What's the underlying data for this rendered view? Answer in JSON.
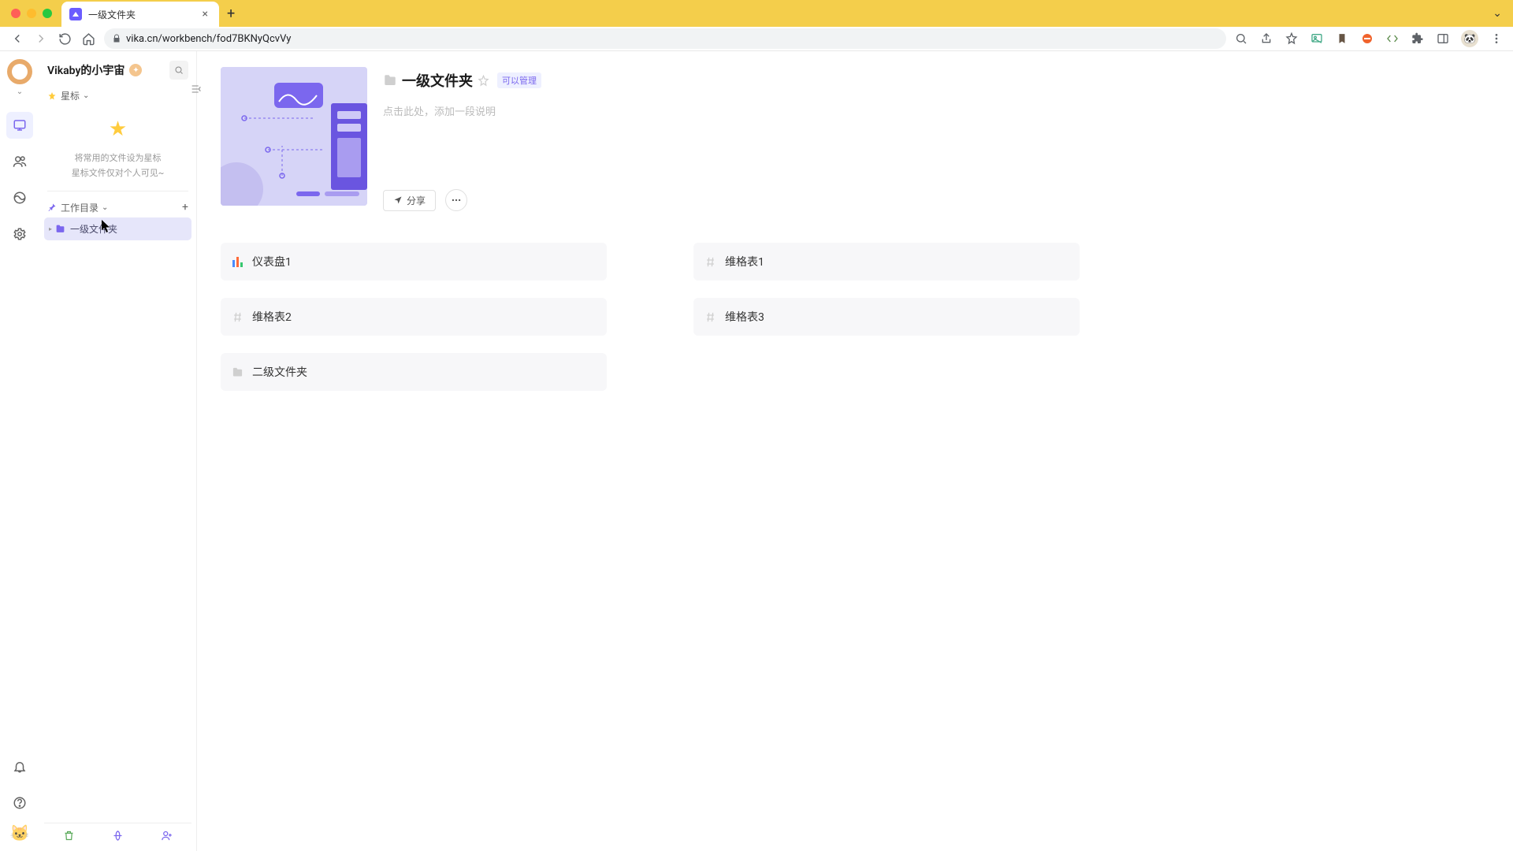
{
  "browser": {
    "tab_title": "一级文件夹",
    "url": "vika.cn/workbench/fod7BKNyQcvVy"
  },
  "workspace": {
    "name": "Vikaby的小宇宙"
  },
  "sidebar": {
    "starred": {
      "label": "星标",
      "empty_line1": "将常用的文件设为星标",
      "empty_line2": "星标文件仅对个人可见~"
    },
    "workdir": {
      "label": "工作目录"
    },
    "items": [
      {
        "label": "一级文件夹"
      }
    ]
  },
  "folder": {
    "title": "一级文件夹",
    "permission_badge": "可以管理",
    "desc_placeholder": "点击此处，添加一段说明",
    "share_label": "分享"
  },
  "contents": [
    {
      "icon": "dashboard",
      "label": "仪表盘1"
    },
    {
      "icon": "grid",
      "label": "维格表1"
    },
    {
      "icon": "grid",
      "label": "维格表2"
    },
    {
      "icon": "grid",
      "label": "维格表3"
    },
    {
      "icon": "folder",
      "label": "二级文件夹"
    }
  ]
}
